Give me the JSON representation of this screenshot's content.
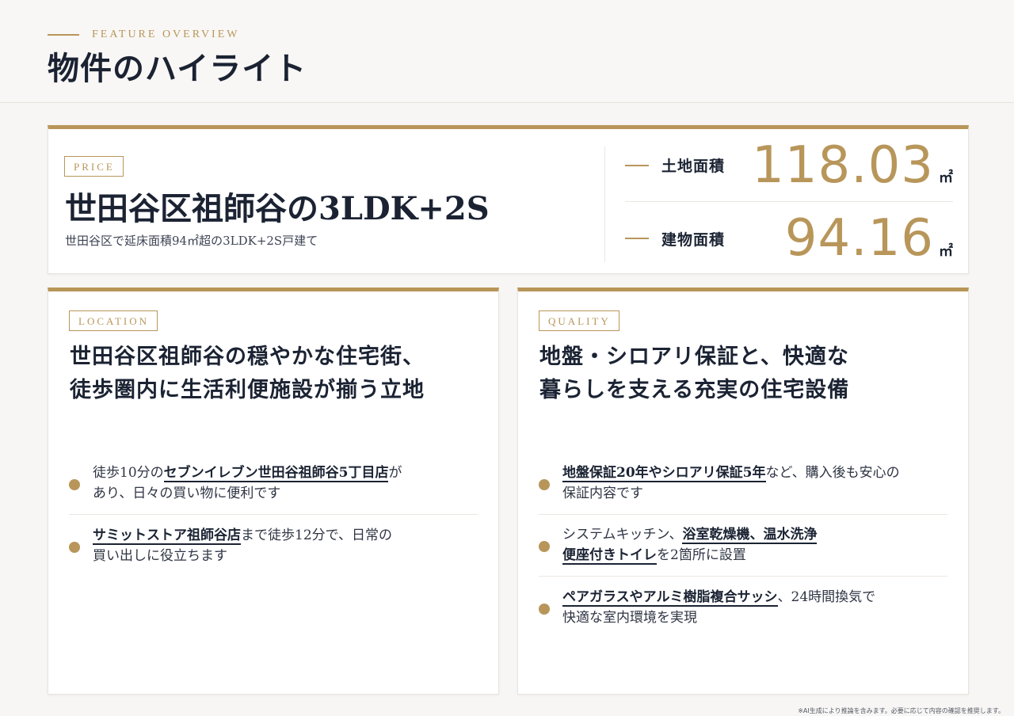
{
  "header": {
    "eyebrow": "FEATURE OVERVIEW",
    "title": "物件のハイライト"
  },
  "price_card": {
    "tag": "PRICE",
    "title": "世田谷区祖師谷の3LDK+2S",
    "subtitle": "世田谷区で延床面積94㎡超の3LDK+2S戸建て",
    "areas": [
      {
        "label": "土地面積",
        "value": "118.03",
        "unit": "㎡"
      },
      {
        "label": "建物面積",
        "value": "94.16",
        "unit": "㎡"
      }
    ]
  },
  "location": {
    "tag": "LOCATION",
    "heading_line1": "世田谷区祖師谷の穏やかな住宅街、",
    "heading_line2": "徒歩圏内に生活利便施設が揃う立地",
    "bullets": [
      {
        "line1_pre": "徒歩10分の",
        "line1_em": "セブンイレブン世田谷祖師谷5丁目店",
        "line1_post": "が",
        "line2": "あり、日々の買い物に便利です"
      },
      {
        "line1_em": "サミットストア祖師谷店",
        "line1_post": "まで徒歩12分で、日常の",
        "line2": "買い出しに役立ちます"
      }
    ]
  },
  "quality": {
    "tag": "QUALITY",
    "heading_line1": "地盤・シロアリ保証と、快適な",
    "heading_line2": "暮らしを支える充実の住宅設備",
    "bullets": [
      {
        "line1_em": "地盤保証20年やシロアリ保証5年",
        "line1_post": "など、購入後も安心の",
        "line2": "保証内容です"
      },
      {
        "line1_pre": "システムキッチン、",
        "line1_em": "浴室乾燥機、温水洗浄",
        "line2_em": "便座付きトイレ",
        "line2_post": "を2箇所に設置"
      },
      {
        "line1_em": "ペアガラスやアルミ樹脂複合サッシ",
        "line1_post": "、24時間換気で",
        "line2": "快適な室内環境を実現"
      }
    ]
  },
  "footnote": "※AI生成により推論を含みます。必要に応じて内容の確認を推奨します。",
  "colors": {
    "accent_gold": "#b8965a",
    "navy_text": "#1b2333",
    "background": "#f7f6f4"
  }
}
